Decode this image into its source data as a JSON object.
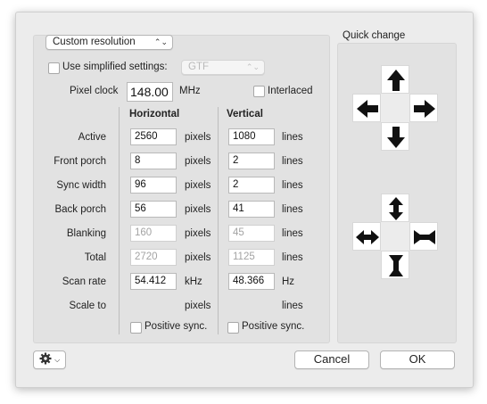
{
  "resolution_popup": {
    "value": "Custom resolution"
  },
  "simplified": {
    "label": "Use simplified settings:",
    "popup_value": "GTF"
  },
  "pixel_clock": {
    "label": "Pixel clock",
    "value": "148.00",
    "unit": "MHz"
  },
  "interlaced": {
    "label": "Interlaced"
  },
  "columns": {
    "horizontal": "Horizontal",
    "vertical": "Vertical"
  },
  "rows": [
    {
      "label": "Active",
      "h": "2560",
      "h_unit": "pixels",
      "v": "1080",
      "v_unit": "lines"
    },
    {
      "label": "Front porch",
      "h": "8",
      "h_unit": "pixels",
      "v": "2",
      "v_unit": "lines"
    },
    {
      "label": "Sync width",
      "h": "96",
      "h_unit": "pixels",
      "v": "2",
      "v_unit": "lines"
    },
    {
      "label": "Back porch",
      "h": "56",
      "h_unit": "pixels",
      "v": "41",
      "v_unit": "lines"
    },
    {
      "label": "Blanking",
      "h": "160",
      "h_unit": "pixels",
      "v": "45",
      "v_unit": "lines"
    },
    {
      "label": "Total",
      "h": "2720",
      "h_unit": "pixels",
      "v": "1125",
      "v_unit": "lines"
    },
    {
      "label": "Scan rate",
      "h": "54.412",
      "h_unit": "kHz",
      "v": "48.366",
      "v_unit": "Hz"
    },
    {
      "label": "Scale to",
      "h_unit": "pixels",
      "v_unit": "lines"
    }
  ],
  "positive_sync": {
    "h_label": "Positive sync.",
    "v_label": "Positive sync."
  },
  "quick_change": {
    "title": "Quick change"
  },
  "footer": {
    "cancel": "Cancel",
    "ok": "OK"
  },
  "icons": {
    "gear": "gear-icon",
    "popup_chevron": "updown-chevron-icon",
    "move_arrows": [
      "arrow-up-icon",
      "arrow-left-icon",
      "arrow-right-icon",
      "arrow-down-icon"
    ],
    "size_arrows": [
      "expand-vertical-icon",
      "expand-horizontal-icon",
      "shrink-horizontal-icon",
      "shrink-vertical-icon"
    ]
  },
  "colors": {
    "window_bg": "#ececec",
    "panel_bg": "#e2e2e2"
  }
}
